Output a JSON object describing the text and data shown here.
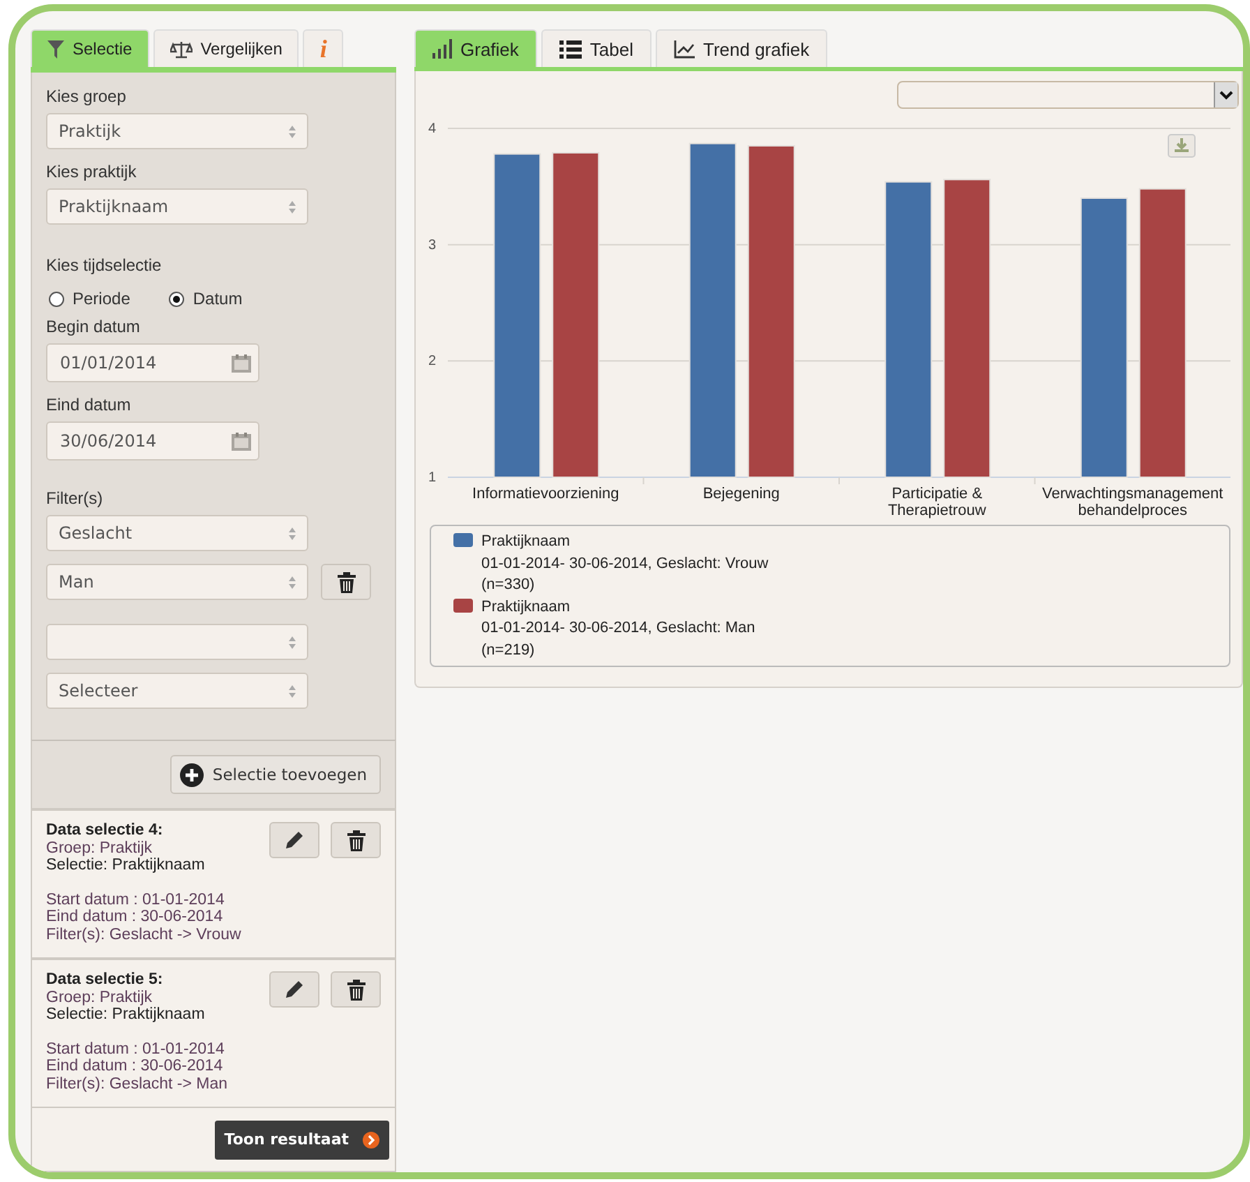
{
  "left_tabs": [
    {
      "label": "Selectie",
      "selected": true
    },
    {
      "label": "Vergelijken",
      "selected": false
    },
    {
      "label": "i",
      "selected": false
    }
  ],
  "group": {
    "label": "Kies groep",
    "value": "Praktijk"
  },
  "practice": {
    "label": "Kies praktijk",
    "value": "Praktijknaam"
  },
  "time_selection": {
    "label": "Kies tijdselectie",
    "options": [
      {
        "label": "Periode",
        "selected": false
      },
      {
        "label": "Datum",
        "selected": true
      }
    ]
  },
  "begin_date": {
    "label": "Begin datum",
    "value": "01/01/2014"
  },
  "end_date": {
    "label": "Eind datum",
    "value": "30/06/2014"
  },
  "filters": {
    "label": "Filter(s)",
    "groups": [
      {
        "field": "Geslacht",
        "value": "Man",
        "deletable": true
      },
      {
        "value": "Selecteer",
        "deletable": false
      }
    ]
  },
  "add_button": "Selectie toevoegen",
  "selections": [
    {
      "title": "Data selectie 4:",
      "group": "Groep: Praktijk",
      "selection": "Selectie: Praktijknaam",
      "start": "Start datum : 01-01-2014",
      "end": "Eind datum : 30-06-2014",
      "filter": "Filter(s): Geslacht -> Vrouw"
    },
    {
      "title": "Data selectie 5:",
      "group": "Groep: Praktijk",
      "selection": "Selectie: Praktijknaam",
      "start": "Start datum : 01-01-2014",
      "end": "Eind datum : 30-06-2014",
      "filter": "Filter(s): Geslacht -> Man"
    }
  ],
  "result_button": "Toon resultaat",
  "right_tabs": [
    {
      "label": "Grafiek",
      "selected": true
    },
    {
      "label": "Tabel",
      "selected": false
    },
    {
      "label": "Trend grafiek",
      "selected": false
    }
  ],
  "chart_data": {
    "type": "bar",
    "categories": [
      "Informatievoorziening",
      "Bejegening",
      "Participatie & Therapietrouw",
      "Verwachtingsmanagement behandelproces"
    ],
    "ylim": [
      1,
      4
    ],
    "yticks": [
      1,
      2,
      3,
      4
    ],
    "series": [
      {
        "name": "Praktijknaam",
        "color": "#4470a6",
        "values": [
          3.78,
          3.87,
          3.54,
          3.4
        ]
      },
      {
        "name": "Praktijknaam",
        "color": "#a84444",
        "values": [
          3.79,
          3.85,
          3.56,
          3.48
        ]
      }
    ]
  },
  "legend": [
    {
      "period": "01-01-2014- 30-06-2014, Geslacht: Vrouw",
      "count": "(n=330)"
    },
    {
      "period": "01-01-2014- 30-06-2014, Geslacht: Man",
      "count": "(n=219)"
    }
  ]
}
